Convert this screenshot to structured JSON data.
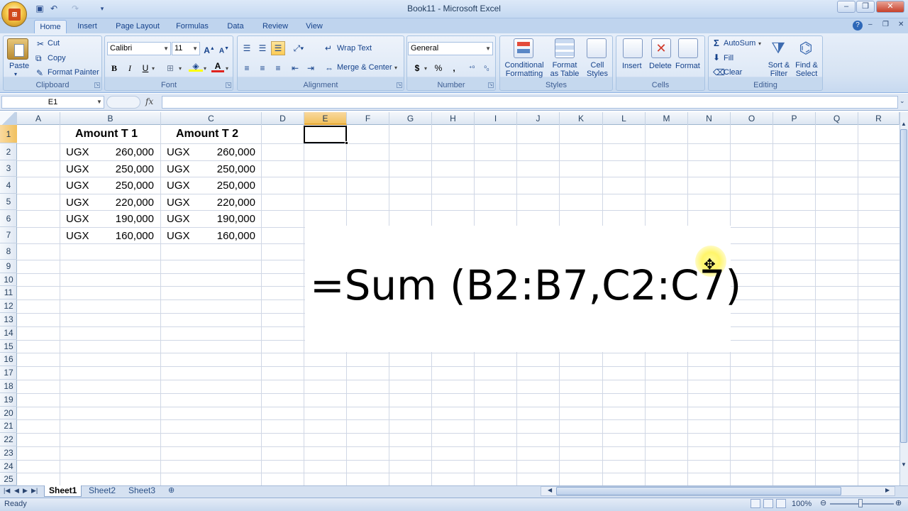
{
  "window": {
    "title": "Book11 - Microsoft Excel"
  },
  "ribbon_tabs": [
    "Home",
    "Insert",
    "Page Layout",
    "Formulas",
    "Data",
    "Review",
    "View"
  ],
  "clipboard": {
    "paste": "Paste",
    "cut": "Cut",
    "copy": "Copy",
    "format_painter": "Format Painter",
    "label": "Clipboard"
  },
  "font": {
    "name": "Calibri",
    "size": "11",
    "label": "Font",
    "bold": "B",
    "italic": "I",
    "underline": "U"
  },
  "alignment": {
    "wrap_text": "Wrap Text",
    "merge_center": "Merge & Center",
    "label": "Alignment"
  },
  "number": {
    "format": "General",
    "currency": "$",
    "percent": "%",
    "comma": ",",
    "label": "Number"
  },
  "styles": {
    "conditional": [
      "Conditional",
      "Formatting"
    ],
    "format_table": [
      "Format",
      "as Table"
    ],
    "cell_styles": [
      "Cell",
      "Styles"
    ],
    "label": "Styles"
  },
  "cells": {
    "insert": "Insert",
    "delete": "Delete",
    "format": "Format",
    "label": "Cells"
  },
  "editing": {
    "autosum": "AutoSum",
    "fill": "Fill",
    "clear": "Clear",
    "sort_filter": [
      "Sort &",
      "Filter"
    ],
    "find_select": [
      "Find &",
      "Select"
    ],
    "label": "Editing"
  },
  "formula_bar": {
    "name_box": "E1",
    "fx": "fx",
    "value": ""
  },
  "columns": [
    "A",
    "B",
    "C",
    "D",
    "E",
    "F",
    "G",
    "H",
    "I",
    "J",
    "K",
    "L",
    "M",
    "N",
    "O",
    "P",
    "Q",
    "R"
  ],
  "rows": [
    "1",
    "2",
    "3",
    "4",
    "5",
    "6",
    "7",
    "8",
    "9",
    "10",
    "11",
    "12",
    "13",
    "14",
    "15",
    "16",
    "17",
    "18",
    "19",
    "20",
    "21",
    "22",
    "23",
    "24",
    "25"
  ],
  "sheet": {
    "headers": [
      "Amount  T 1",
      "Amount  T 2"
    ],
    "currency": "UGX",
    "b_values": [
      "260,000",
      "250,000",
      "250,000",
      "220,000",
      "190,000",
      "160,000"
    ],
    "c_values": [
      "260,000",
      "250,000",
      "250,000",
      "220,000",
      "190,000",
      "160,000"
    ]
  },
  "overlay": {
    "formula": "=Sum (B2:B7,C2:C7)"
  },
  "sheet_tabs": [
    "Sheet1",
    "Sheet2",
    "Sheet3"
  ],
  "status": {
    "ready": "Ready",
    "zoom": "100%"
  }
}
